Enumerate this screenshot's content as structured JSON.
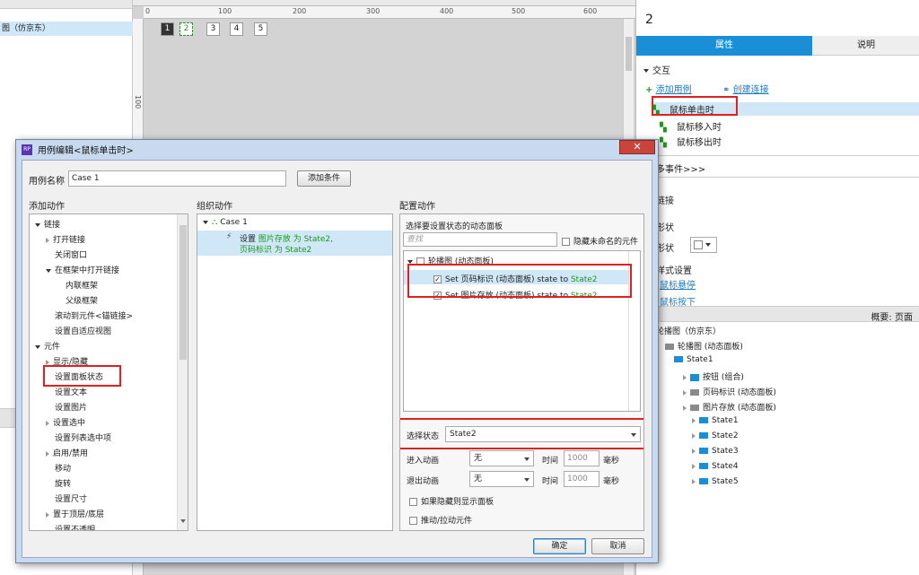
{
  "left_pane": {
    "selected_page": "图（仿京东）"
  },
  "canvas": {
    "ruler_ticks": [
      "0",
      "100",
      "200",
      "300",
      "400",
      "500",
      "600"
    ],
    "ruler_left_tick": "100",
    "pager": [
      "1",
      "2",
      "3",
      "4",
      "5"
    ]
  },
  "right_pane": {
    "title": "2",
    "tab_properties": "属性",
    "tab_notes": "说明",
    "section_interaction": "交互",
    "add_case": "添加用例",
    "create_link": "创建连接",
    "events": [
      "鼠标单击时",
      "鼠标移入时",
      "鼠标移出时"
    ],
    "more_events": "多事件>>>",
    "link_label": "链接",
    "shape_label": "形状",
    "shape_select": "形状",
    "style_label": "样式设置",
    "mouse_hover": "鼠标悬停",
    "mouse_down": "鼠标按下",
    "outline_title": "概要: 页面",
    "outline_items": [
      {
        "label": "轮播图（仿京东）",
        "indent": 0,
        "icon": "none"
      },
      {
        "label": "轮播图 (动态面板)",
        "indent": 1,
        "icon": "gray"
      },
      {
        "label": "State1",
        "indent": 2,
        "icon": "blue"
      },
      {
        "label": "按钮 (组合)",
        "indent": 3,
        "icon": "folder"
      },
      {
        "label": "页码标识 (动态面板)",
        "indent": 3,
        "icon": "gray"
      },
      {
        "label": "图片存放 (动态面板)",
        "indent": 3,
        "icon": "gray"
      },
      {
        "label": "State1",
        "indent": 4,
        "icon": "blue"
      },
      {
        "label": "State2",
        "indent": 4,
        "icon": "blue"
      },
      {
        "label": "State3",
        "indent": 4,
        "icon": "blue"
      },
      {
        "label": "State4",
        "indent": 4,
        "icon": "blue"
      },
      {
        "label": "State5",
        "indent": 4,
        "icon": "blue"
      }
    ]
  },
  "dialog": {
    "app_icon": "RP",
    "title": "用例编辑<鼠标单击时>",
    "close": "✕",
    "case_name_label": "用例名称",
    "case_name_value": "Case 1",
    "add_condition": "添加条件",
    "col_add_action": "添加动作",
    "col_organize": "组织动作",
    "col_configure": "配置动作",
    "actions": [
      {
        "label": "链接",
        "indent": 0,
        "tri": "down"
      },
      {
        "label": "打开链接",
        "indent": 1,
        "tri": "right"
      },
      {
        "label": "关闭窗口",
        "indent": 1,
        "tri": "none"
      },
      {
        "label": "在框架中打开链接",
        "indent": 1,
        "tri": "down"
      },
      {
        "label": "内联框架",
        "indent": 2,
        "tri": "none"
      },
      {
        "label": "父级框架",
        "indent": 2,
        "tri": "none"
      },
      {
        "label": "滚动到元件<锚链接>",
        "indent": 1,
        "tri": "none"
      },
      {
        "label": "设置自适应视图",
        "indent": 1,
        "tri": "none"
      },
      {
        "label": "元件",
        "indent": 0,
        "tri": "down"
      },
      {
        "label": "显示/隐藏",
        "indent": 1,
        "tri": "right"
      },
      {
        "label": "设置面板状态",
        "indent": 1,
        "tri": "none"
      },
      {
        "label": "设置文本",
        "indent": 1,
        "tri": "none"
      },
      {
        "label": "设置图片",
        "indent": 1,
        "tri": "none"
      },
      {
        "label": "设置选中",
        "indent": 1,
        "tri": "right"
      },
      {
        "label": "设置列表选中项",
        "indent": 1,
        "tri": "none"
      },
      {
        "label": "启用/禁用",
        "indent": 1,
        "tri": "right"
      },
      {
        "label": "移动",
        "indent": 1,
        "tri": "none"
      },
      {
        "label": "旋转",
        "indent": 1,
        "tri": "none"
      },
      {
        "label": "设置尺寸",
        "indent": 1,
        "tri": "none"
      },
      {
        "label": "置于顶层/底层",
        "indent": 1,
        "tri": "right"
      },
      {
        "label": "设置不透明",
        "indent": 1,
        "tri": "none"
      }
    ],
    "organize": {
      "case": "Case 1",
      "action_prefix1": "设置",
      "action_green1": "图片存放 为 State2,",
      "action_green2": "页码标识 为 State2"
    },
    "configure": {
      "heading": "选择要设置状态的动态面板",
      "search_placeholder": "查找",
      "hide_unnamed": "隐藏未命名的元件",
      "root": "轮播图 (动态面板)",
      "items": [
        {
          "prefix": "Set 页码标识 (动态面板) state to ",
          "state": "State2"
        },
        {
          "prefix": "Set 图片存放 (动态面板) state to ",
          "state": "State2"
        }
      ],
      "select_state_label": "选择状态",
      "select_state_value": "State2",
      "enter_anim_label": "进入动画",
      "enter_anim_value": "无",
      "exit_anim_label": "退出动画",
      "exit_anim_value": "无",
      "time_label": "时间",
      "time_value": "1000",
      "ms": "毫秒",
      "show_if_hidden": "如果隐藏则显示面板",
      "push_pull": "推动/拉动元件"
    },
    "ok": "确定",
    "cancel": "取消"
  }
}
